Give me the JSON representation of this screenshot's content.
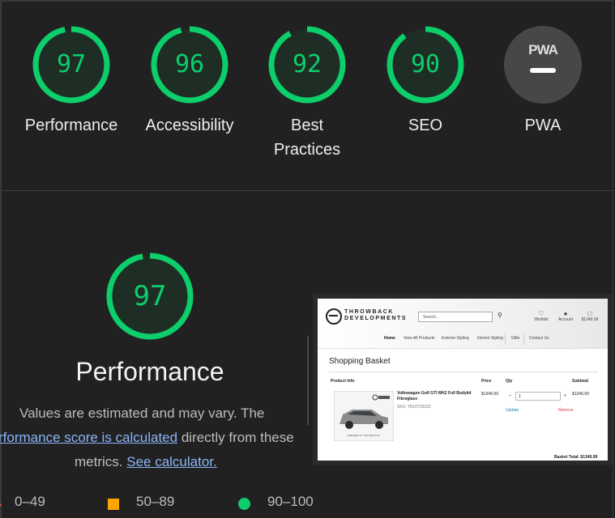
{
  "scores": [
    {
      "value": "97",
      "label": "Performance",
      "fraction": 0.97
    },
    {
      "value": "96",
      "label": "Accessibility",
      "fraction": 0.96
    },
    {
      "value": "92",
      "label": "Best",
      "label2": "Practices",
      "fraction": 0.92
    },
    {
      "value": "90",
      "label": "SEO",
      "fraction": 0.9
    },
    {
      "value": "PWA",
      "label": "PWA"
    }
  ],
  "detail": {
    "value": "97",
    "fraction": 0.97,
    "title": "Performance",
    "desc1": "Values are estimated and may vary. The",
    "desc_link": "rformance score is calculated",
    "desc2": " directly from these",
    "desc3": "metrics. ",
    "calc_link": "See calculator."
  },
  "legend": {
    "low": "0–49",
    "mid": "50–89",
    "high": "90–100"
  },
  "colors": {
    "pass": "#0cce6b",
    "average": "#ffa400",
    "fail": "#ff4e42",
    "pwa_bg": "#474747"
  },
  "screenshot": {
    "logo_line1": "THROWBACK",
    "logo_line2": "DEVELOPMENTS",
    "search_placeholder": "Search...",
    "wishlist": "Wishlist",
    "account": "Account",
    "basket_total_top": "$1349.99",
    "nav": [
      "Home",
      "View All Products",
      "Exterior Styling",
      "Interior Styling",
      "Gifts",
      "Contact Us"
    ],
    "page_title": "Shopping Basket",
    "col_product": "Product Info",
    "col_price": "Price",
    "col_qty": "Qty",
    "col_subtotal": "Subtotal",
    "product_name": "Volkswagen Golf GTI MK2 Full Bodykit",
    "product_name2": "Fibreglass",
    "sku": "SKU: TB10733232",
    "price": "$1349.99",
    "qty": "1",
    "subtotal": "$1349.99",
    "update": "Update",
    "remove": "Remove",
    "basket_total": "Basket Total: $1349.99",
    "thumb_caption": "PREVIEW OF 'TEX' BODYKIT"
  }
}
